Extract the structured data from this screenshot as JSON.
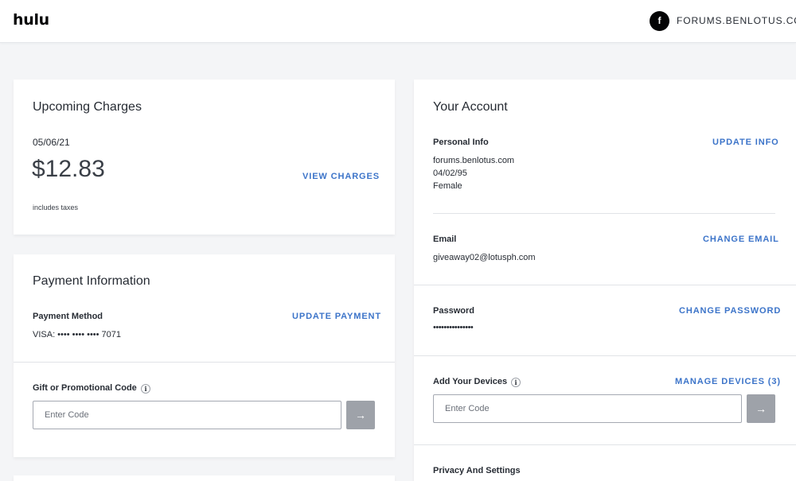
{
  "header": {
    "logo": "hulu",
    "avatar_letter": "f",
    "username": "FORUMS.BENLOTUS.COM"
  },
  "upcoming": {
    "title": "Upcoming Charges",
    "date": "05/06/21",
    "amount": "$12.83",
    "note": "includes taxes",
    "view_charges": "VIEW CHARGES"
  },
  "payment": {
    "title": "Payment Information",
    "method_label": "Payment Method",
    "method_value": "VISA: •••• •••• •••• 7071",
    "update_payment": "UPDATE PAYMENT",
    "gift_label": "Gift or Promotional Code",
    "gift_placeholder": "Enter Code",
    "submit_icon": "arrow-right-icon"
  },
  "account": {
    "title": "Your Account",
    "personal_label": "Personal Info",
    "update_info": "UPDATE INFO",
    "personal_name": "forums.benlotus.com",
    "personal_dob": "04/02/95",
    "personal_gender": "Female",
    "email_label": "Email",
    "change_email": "CHANGE EMAIL",
    "email_value": "giveaway02@lotusph.com",
    "password_label": "Password",
    "change_password": "CHANGE PASSWORD",
    "password_value": "•••••••••••••••",
    "devices_label": "Add Your Devices",
    "manage_devices": "MANAGE DEVICES (3)",
    "devices_placeholder": "Enter Code",
    "privacy_label": "Privacy And Settings"
  },
  "colors": {
    "link": "#3c74c9",
    "background": "#f4f5f7",
    "button_disabled": "#9ea2a9"
  }
}
